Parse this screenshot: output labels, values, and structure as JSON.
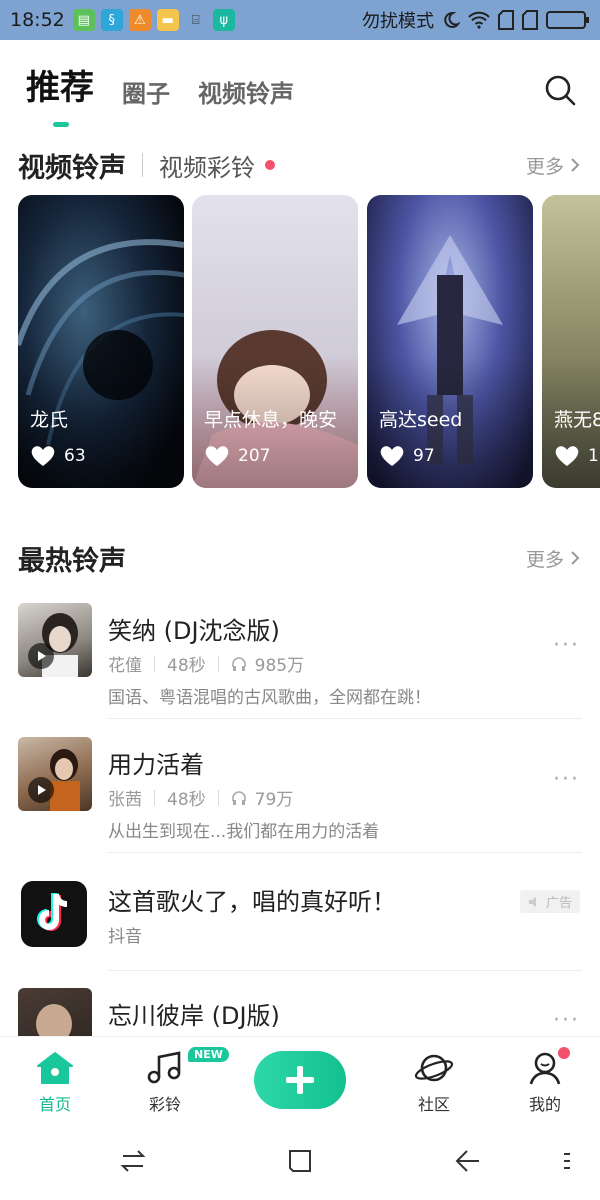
{
  "status_bar": {
    "time": "18:52",
    "dnd_text": "勿扰模式"
  },
  "top_tabs": {
    "active": "推荐",
    "tabs": [
      "圈子",
      "视频铃声"
    ]
  },
  "video_section": {
    "title": "视频铃声",
    "subtitle": "视频彩铃",
    "more": "更多",
    "cards": [
      {
        "title": "龙氏",
        "likes": "63"
      },
      {
        "title": "早点休息，晚安",
        "likes": "207"
      },
      {
        "title": "高达seed",
        "likes": "97"
      },
      {
        "title": "燕无8",
        "likes": "1"
      }
    ]
  },
  "hot_section": {
    "title": "最热铃声",
    "more": "更多",
    "songs": [
      {
        "title": "笑纳 (DJ沈念版)",
        "artist": "花僮",
        "duration": "48秒",
        "plays": "985万",
        "desc": "国语、粤语混唱的古风歌曲，全网都在跳！"
      },
      {
        "title": "用力活着",
        "artist": "张茜",
        "duration": "48秒",
        "plays": "79万",
        "desc": "从出生到现在...我们都在用力的活着"
      },
      {
        "title": "这首歌火了，唱的真好听！",
        "source": "抖音",
        "ad_label": "广告"
      },
      {
        "title": "忘川彼岸 (DJ版)"
      }
    ]
  },
  "bottom_nav": {
    "items": [
      {
        "label": "首页",
        "icon": "home-icon"
      },
      {
        "label": "彩铃",
        "icon": "music-note-icon"
      },
      {
        "label": "社区",
        "icon": "planet-icon"
      },
      {
        "label": "我的",
        "icon": "user-icon"
      }
    ],
    "new_badge": "NEW"
  },
  "colors": {
    "accent": "#19c79b",
    "status_bar": "#7ea3d1",
    "red_dot": "#f2506d"
  }
}
